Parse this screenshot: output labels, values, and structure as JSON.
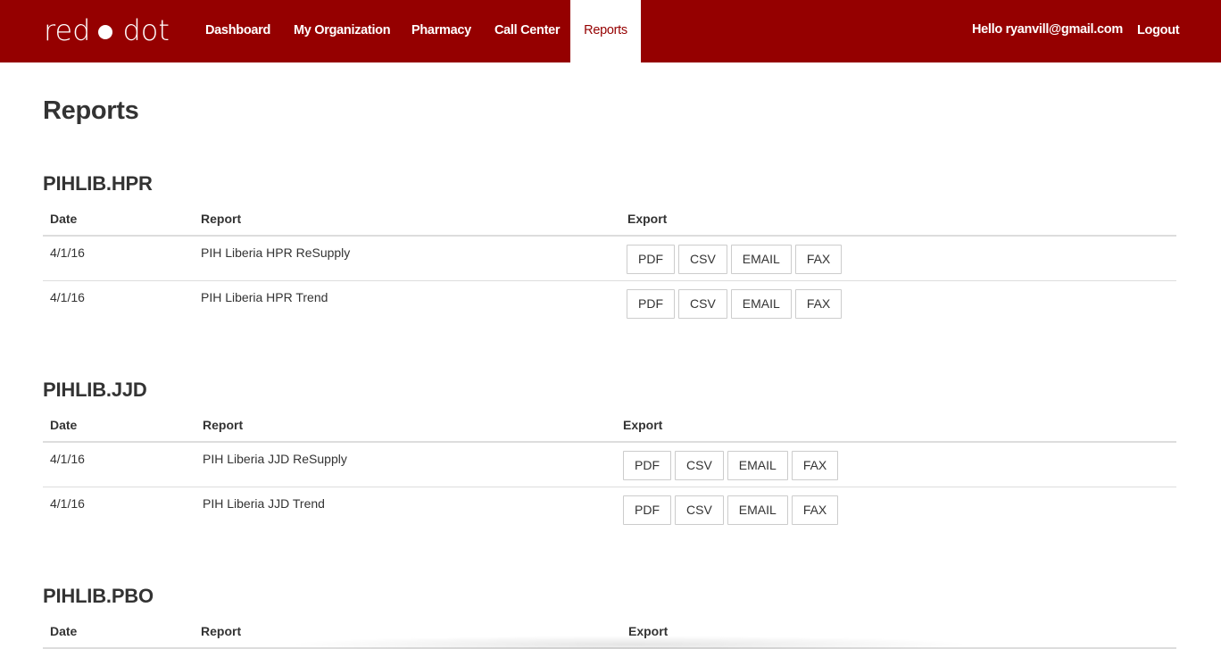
{
  "brand": {
    "left": "red",
    "right": "dot"
  },
  "nav": {
    "items": [
      {
        "label": "Dashboard"
      },
      {
        "label": "My Organization"
      },
      {
        "label": "Pharmacy"
      },
      {
        "label": "Call Center"
      },
      {
        "label": "Reports",
        "active": true
      }
    ],
    "greeting": "Hello ryanvill@gmail.com",
    "logout": "Logout"
  },
  "page_title": "Reports",
  "headers": {
    "date": "Date",
    "report": "Report",
    "export": "Export"
  },
  "buttons": {
    "pdf": "PDF",
    "csv": "CSV",
    "email": "EMAIL",
    "fax": "FAX"
  },
  "sections": [
    {
      "title": "PIHLIB.HPR",
      "rows": [
        {
          "date": "4/1/16",
          "report": "PIH Liberia HPR ReSupply"
        },
        {
          "date": "4/1/16",
          "report": "PIH Liberia HPR Trend"
        }
      ]
    },
    {
      "title": "PIHLIB.JJD",
      "rows": [
        {
          "date": "4/1/16",
          "report": "PIH Liberia JJD ReSupply"
        },
        {
          "date": "4/1/16",
          "report": "PIH Liberia JJD Trend"
        }
      ]
    },
    {
      "title": "PIHLIB.PBO",
      "rows": []
    }
  ],
  "colors": {
    "brand": "#950000",
    "text": "#333333",
    "border": "#dddddd"
  }
}
